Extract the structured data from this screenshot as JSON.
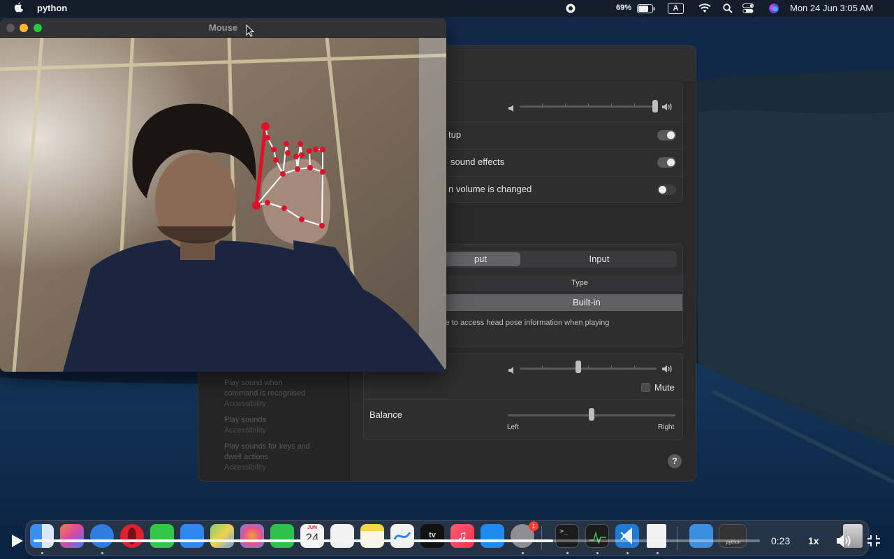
{
  "menubar": {
    "app_name": "python",
    "battery_percent": "69%",
    "input_source": "A",
    "datetime": "Mon 24 Jun  3:05 AM",
    "icons": [
      "apple-icon",
      "record-icon",
      "battery-icon",
      "input-source-icon",
      "wifi-icon",
      "spotlight-icon",
      "control-center-icon",
      "siri-icon"
    ]
  },
  "camera_window": {
    "title": "Mouse",
    "content": "webcam feed with hand landmark overlay"
  },
  "sound_settings": {
    "sidebar_results": [
      {
        "title": "Play sound when command is recognised",
        "category": "Accessibility"
      },
      {
        "title": "Play sounds",
        "category": "Accessibility"
      },
      {
        "title": "Play sounds for keys and dwell actions",
        "category": "Accessibility"
      }
    ],
    "sound_effects": {
      "row_startup": "tup",
      "row_ui_effects": "sound effects",
      "row_volume_feedback": "n volume is changed",
      "toggle_startup": true,
      "toggle_ui_effects": true,
      "toggle_volume_feedback": false,
      "alert_volume_level": 1.0
    },
    "device_tabs": {
      "output_label": "put",
      "input_label": "Input",
      "selected": "Output"
    },
    "device_table": {
      "column_type": "Type",
      "selected_type": "Built-in",
      "note": "ble to access head pose information when playing"
    },
    "output_volume_level": 0.43,
    "mute_label": "Mute",
    "mute_checked": false,
    "balance": {
      "label": "Balance",
      "left_label": "Left",
      "right_label": "Right",
      "value": 0.5
    },
    "help_label": "?"
  },
  "dock": {
    "apps": [
      "finder-icon",
      "launchpad-icon",
      "safari-icon",
      "opera-icon",
      "messages-icon",
      "mail-icon",
      "maps-icon",
      "photos-icon",
      "facetime-icon",
      "calendar-icon",
      "reminders-icon",
      "notes-icon",
      "freeform-icon",
      "apple-tv-icon",
      "music-icon",
      "app-store-icon",
      "system-settings-icon",
      "terminal-icon",
      "activity-monitor-icon",
      "vscode-icon",
      "document-icon",
      "downloads-folder-icon",
      "python-window-icon",
      "trash-icon"
    ],
    "calendar_month": "JUN",
    "calendar_day": "24",
    "appletv_label": "tv",
    "settings_badge": "1",
    "python_window_label": "python"
  },
  "player": {
    "current_time": "0:23",
    "speed": "1x",
    "progress": 0.715
  },
  "colors": {
    "hand_landmark": "#e0102a",
    "hand_connection": "#ffffff",
    "close": "#ff5f57",
    "minimize": "#febc2e",
    "maximize": "#28c840"
  }
}
